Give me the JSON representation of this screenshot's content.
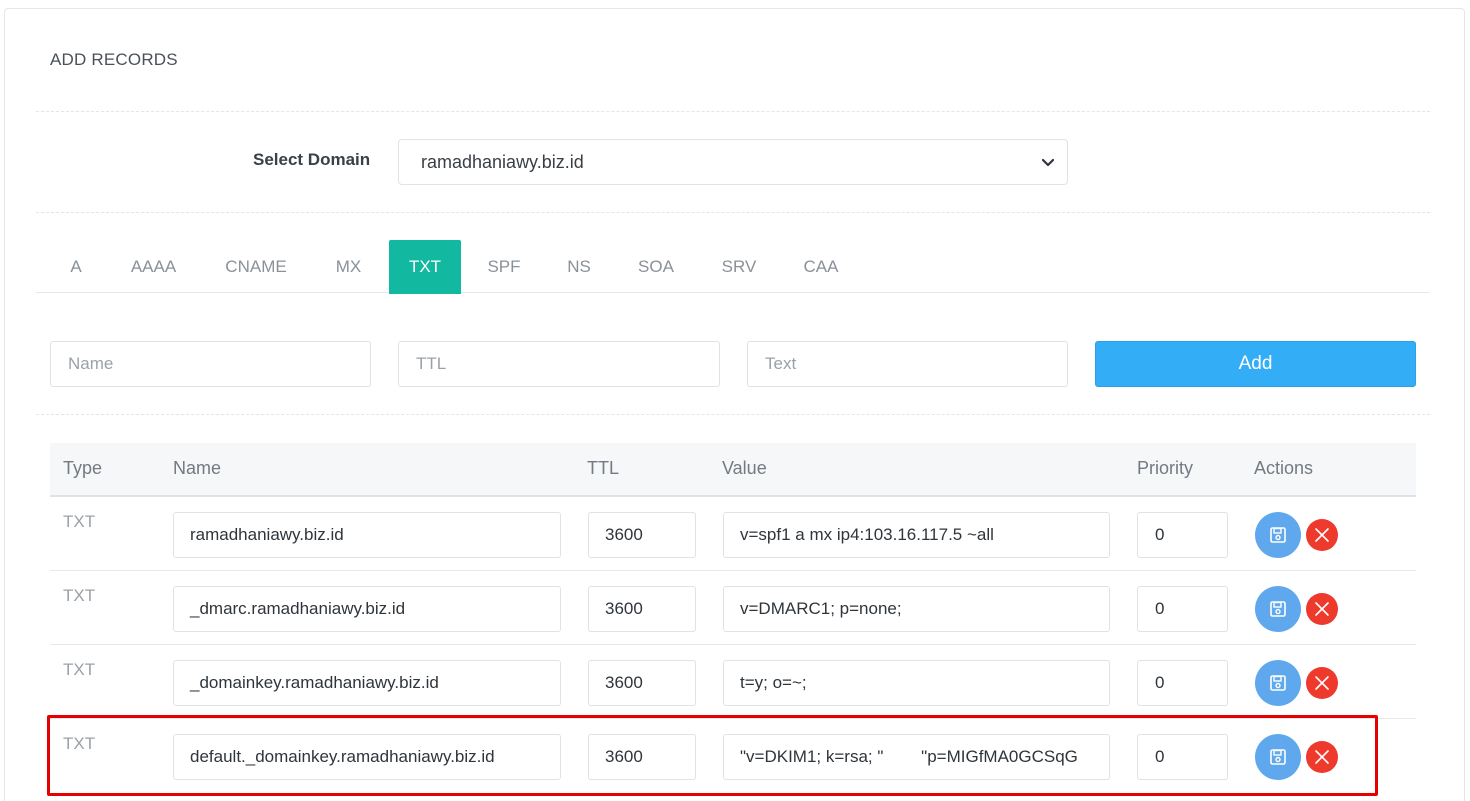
{
  "card": {
    "title": "ADD RECORDS"
  },
  "domain": {
    "label": "Select Domain",
    "selected": "ramadhaniawy.biz.id"
  },
  "tabs": [
    {
      "label": "A"
    },
    {
      "label": "AAAA"
    },
    {
      "label": "CNAME"
    },
    {
      "label": "MX"
    },
    {
      "label": "TXT",
      "active": true
    },
    {
      "label": "SPF"
    },
    {
      "label": "NS"
    },
    {
      "label": "SOA"
    },
    {
      "label": "SRV"
    },
    {
      "label": "CAA"
    }
  ],
  "form": {
    "name_placeholder": "Name",
    "ttl_placeholder": "TTL",
    "text_placeholder": "Text",
    "add_label": "Add"
  },
  "table": {
    "headers": [
      "Type",
      "Name",
      "TTL",
      "Value",
      "Priority",
      "Actions"
    ],
    "rows": [
      {
        "type": "TXT",
        "name": "ramadhaniawy.biz.id",
        "ttl": "3600",
        "value": "v=spf1 a mx ip4:103.16.117.5 ~all",
        "priority": "0"
      },
      {
        "type": "TXT",
        "name": "_dmarc.ramadhaniawy.biz.id",
        "ttl": "3600",
        "value": "v=DMARC1; p=none;",
        "priority": "0"
      },
      {
        "type": "TXT",
        "name": "_domainkey.ramadhaniawy.biz.id",
        "ttl": "3600",
        "value": "t=y; o=~;",
        "priority": "0"
      },
      {
        "type": "TXT",
        "name": "default._domainkey.ramadhaniawy.biz.id",
        "ttl": "3600",
        "value": "\"v=DKIM1; k=rsa; \"        \"p=MIGfMA0GCSqG",
        "priority": "0"
      }
    ]
  },
  "colors": {
    "accent_tab": "#12b8a0",
    "add_button": "#33aef6",
    "save_button": "#5fa8ee",
    "delete_button": "#ee3a2c",
    "highlight": "#e60000"
  },
  "icons": {
    "save": "floppy-disk-icon",
    "delete": "close-icon",
    "select": "chevron-down-icon"
  }
}
